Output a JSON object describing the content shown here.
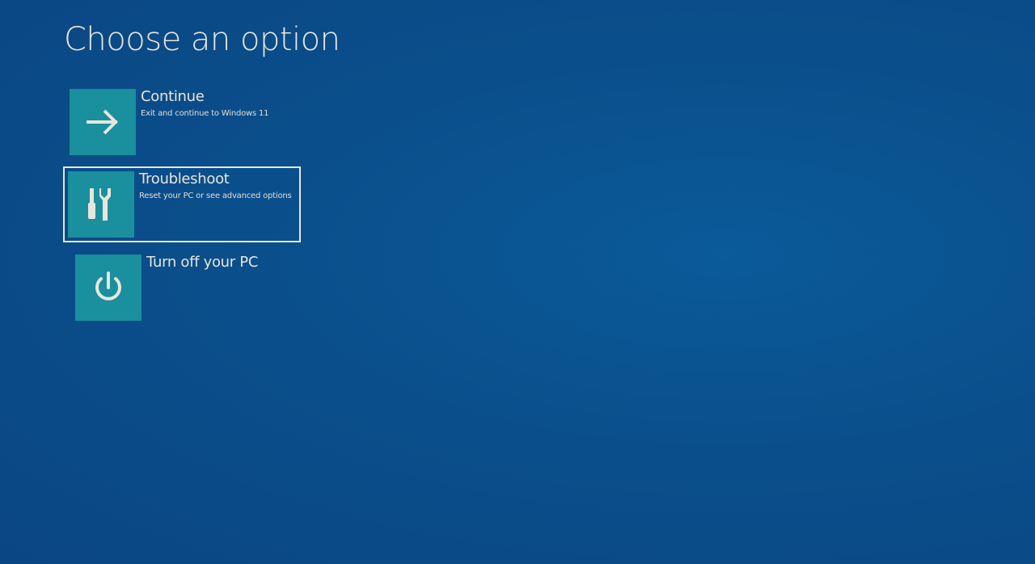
{
  "page": {
    "title": "Choose an option"
  },
  "options": [
    {
      "id": "continue",
      "label": "Continue",
      "description": "Exit and continue to Windows 11",
      "icon": "arrow-right-icon",
      "selected": false
    },
    {
      "id": "troubleshoot",
      "label": "Troubleshoot",
      "description": "Reset your PC or see advanced options",
      "icon": "tools-icon",
      "selected": true
    },
    {
      "id": "turnoff",
      "label": "Turn off your PC",
      "description": "",
      "icon": "power-icon",
      "selected": false
    }
  ],
  "colors": {
    "background": "#0a4f8c",
    "tile": "#1a8f9e",
    "text": "#e8e6dc"
  }
}
